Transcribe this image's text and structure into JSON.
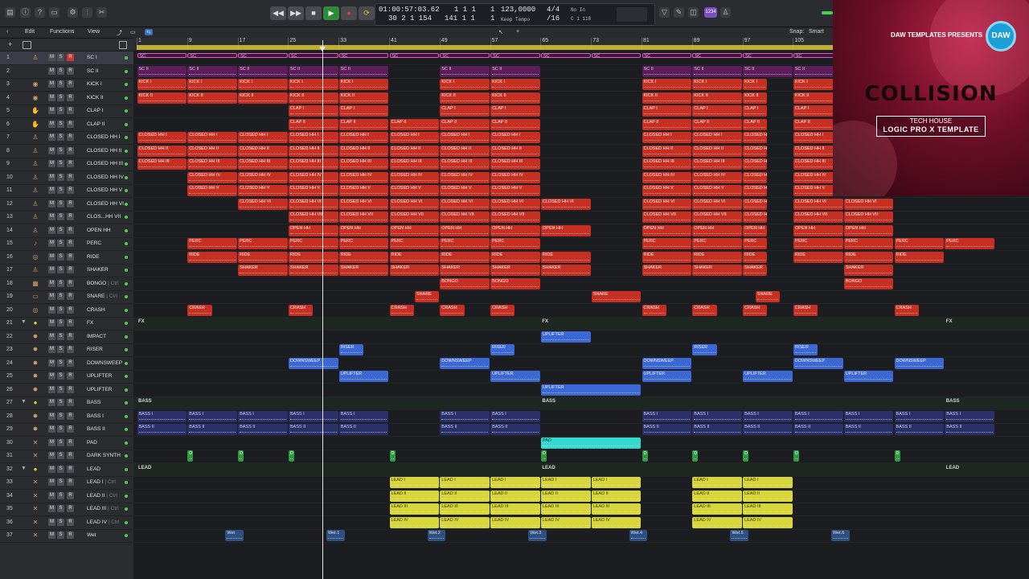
{
  "toolbar": {
    "lcd": {
      "position": "01:00:57:03.62",
      "bars": "30  2  1  154",
      "bar_beat_top": "1  1  1",
      "bar_beat_top_r": "1",
      "bar_beat_bot": "141  1  1",
      "bar_beat_bot_r": "1",
      "tempo": "123,0000",
      "tempo_mode": "Keep Tempo",
      "signature": "4/4",
      "division": "/16",
      "in_label": "No In",
      "out_label": "C  1  118"
    },
    "key_badge": "1234"
  },
  "menubar": {
    "edit": "Edit",
    "functions": "Functions",
    "view": "View",
    "snap_label": "Snap:",
    "snap_value": "Smart"
  },
  "ruler_bars": [
    "1",
    "9",
    "17",
    "25",
    "33",
    "41",
    "49",
    "57",
    "65",
    "73",
    "81",
    "89",
    "97",
    "105"
  ],
  "tracks": [
    {
      "n": "1",
      "name": "SC I",
      "icon": "♙",
      "rec": true
    },
    {
      "n": "2",
      "name": "SC II",
      "icon": ""
    },
    {
      "n": "3",
      "name": "KICK I",
      "icon": "◉"
    },
    {
      "n": "4",
      "name": "KICK II",
      "icon": "◉"
    },
    {
      "n": "5",
      "name": "CLAP I",
      "icon": "✋"
    },
    {
      "n": "6",
      "name": "CLAP II",
      "icon": "✋"
    },
    {
      "n": "7",
      "name": "CLOSED HH I",
      "icon": "♙"
    },
    {
      "n": "8",
      "name": "CLOSED HH II",
      "icon": "♙"
    },
    {
      "n": "9",
      "name": "CLOSED HH III",
      "icon": "♙"
    },
    {
      "n": "10",
      "name": "CLOSED HH IV",
      "icon": "♙"
    },
    {
      "n": "11",
      "name": "CLOSED HH V",
      "icon": "♙"
    },
    {
      "n": "12",
      "name": "CLOSED HH VI",
      "icon": "♙"
    },
    {
      "n": "13",
      "name": "CLOS...HH VII",
      "icon": "♙"
    },
    {
      "n": "14",
      "name": "OPEN HH",
      "icon": "♙"
    },
    {
      "n": "15",
      "name": "PERC",
      "icon": "♪"
    },
    {
      "n": "16",
      "name": "RIDE",
      "icon": "◎"
    },
    {
      "n": "17",
      "name": "SHAKER",
      "icon": "♙"
    },
    {
      "n": "18",
      "name": "BONGO",
      "icon": "▦",
      "suffix": "| Ctrl"
    },
    {
      "n": "19",
      "name": "SNARE",
      "icon": "▭",
      "suffix": "| Ctrl"
    },
    {
      "n": "20",
      "name": "CRASH",
      "icon": "◎"
    },
    {
      "n": "21",
      "name": "FX",
      "icon": "●",
      "folder": true
    },
    {
      "n": "22",
      "name": "IMPACT",
      "icon": "✸"
    },
    {
      "n": "23",
      "name": "RISER",
      "icon": "✸"
    },
    {
      "n": "24",
      "name": "DOWNSWEEP",
      "icon": "✸"
    },
    {
      "n": "25",
      "name": "UPLIFTER",
      "icon": "✸"
    },
    {
      "n": "26",
      "name": "UPLIFTER",
      "icon": "✸"
    },
    {
      "n": "27",
      "name": "BASS",
      "icon": "●",
      "folder": true
    },
    {
      "n": "28",
      "name": "BASS I",
      "icon": "✸"
    },
    {
      "n": "29",
      "name": "BASS II",
      "icon": "✸"
    },
    {
      "n": "30",
      "name": "PAD",
      "icon": "✕"
    },
    {
      "n": "31",
      "name": "DARK SYNTH",
      "icon": "✕"
    },
    {
      "n": "32",
      "name": "LEAD",
      "icon": "●",
      "folder": true
    },
    {
      "n": "33",
      "name": "LEAD I",
      "icon": "✕",
      "suffix": "| Ctrl"
    },
    {
      "n": "34",
      "name": "LEAD II",
      "icon": "✕",
      "suffix": "| Ctrl"
    },
    {
      "n": "35",
      "name": "LEAD III",
      "icon": "✕",
      "suffix": "| Ctrl"
    },
    {
      "n": "36",
      "name": "LEAD IV",
      "icon": "✕",
      "suffix": "| Ctrl"
    },
    {
      "n": "37",
      "name": "Wet",
      "icon": "✕"
    }
  ],
  "group_labels": [
    {
      "text": "FX",
      "row": 20,
      "bars": [
        1,
        65,
        129
      ]
    },
    {
      "text": "BASS",
      "row": 26,
      "bars": [
        1,
        65,
        129
      ]
    },
    {
      "text": "LEAD",
      "row": 31,
      "bars": [
        1,
        65,
        129
      ]
    }
  ],
  "regions": [
    {
      "row": 0,
      "c": "pink",
      "label": "SC",
      "runs": [
        [
          1,
          129
        ]
      ],
      "step": 8
    },
    {
      "row": 1,
      "c": "purple",
      "label": "SC II",
      "runs": [
        [
          1,
          41
        ],
        [
          49,
          65
        ],
        [
          81,
          113
        ]
      ],
      "step": 8
    },
    {
      "row": 2,
      "c": "red",
      "label": "KICK I",
      "runs": [
        [
          1,
          41
        ],
        [
          49,
          65
        ],
        [
          81,
          101
        ],
        [
          105,
          113
        ]
      ],
      "step": 8
    },
    {
      "row": 3,
      "c": "red",
      "label": "KICK II",
      "runs": [
        [
          1,
          41
        ],
        [
          49,
          65
        ],
        [
          81,
          101
        ],
        [
          105,
          113
        ]
      ],
      "step": 8
    },
    {
      "row": 4,
      "c": "red",
      "label": "CLAP I",
      "runs": [
        [
          25,
          41
        ],
        [
          49,
          65
        ],
        [
          81,
          101
        ],
        [
          105,
          113
        ]
      ],
      "step": 8
    },
    {
      "row": 5,
      "c": "red",
      "label": "CLAP II",
      "runs": [
        [
          25,
          65
        ],
        [
          81,
          101
        ],
        [
          105,
          113
        ]
      ],
      "step": 8
    },
    {
      "row": 6,
      "c": "red",
      "label": "CLOSED HH I",
      "runs": [
        [
          1,
          65
        ],
        [
          81,
          101
        ],
        [
          105,
          113
        ]
      ],
      "step": 8
    },
    {
      "row": 7,
      "c": "red",
      "label": "CLOSED HH II",
      "runs": [
        [
          1,
          65
        ],
        [
          81,
          101
        ],
        [
          105,
          113
        ]
      ],
      "step": 8
    },
    {
      "row": 8,
      "c": "red",
      "label": "CLOSED HH III",
      "runs": [
        [
          1,
          65
        ],
        [
          81,
          101
        ],
        [
          105,
          113
        ]
      ],
      "step": 8
    },
    {
      "row": 9,
      "c": "red",
      "label": "CLOSED HH IV",
      "runs": [
        [
          9,
          65
        ],
        [
          81,
          101
        ],
        [
          105,
          113
        ]
      ],
      "step": 8
    },
    {
      "row": 10,
      "c": "red",
      "label": "CLOSED HH V",
      "runs": [
        [
          9,
          65
        ],
        [
          81,
          101
        ],
        [
          105,
          113
        ]
      ],
      "step": 8
    },
    {
      "row": 11,
      "c": "red",
      "label": "CLOSED HH VI",
      "runs": [
        [
          17,
          73
        ],
        [
          81,
          101
        ],
        [
          105,
          121
        ]
      ],
      "step": 8
    },
    {
      "row": 12,
      "c": "red",
      "label": "CLOSED HH VII",
      "runs": [
        [
          25,
          65
        ],
        [
          81,
          101
        ],
        [
          105,
          121
        ]
      ],
      "step": 8
    },
    {
      "row": 13,
      "c": "red",
      "label": "OPEN HH",
      "runs": [
        [
          25,
          73
        ],
        [
          81,
          101
        ],
        [
          105,
          121
        ]
      ],
      "step": 8
    },
    {
      "row": 14,
      "c": "red",
      "label": "PERC",
      "runs": [
        [
          9,
          65
        ],
        [
          81,
          101
        ],
        [
          105,
          137
        ]
      ],
      "step": 8
    },
    {
      "row": 15,
      "c": "red",
      "label": "RIDE",
      "runs": [
        [
          9,
          73
        ],
        [
          81,
          101
        ],
        [
          105,
          129
        ]
      ],
      "step": 8
    },
    {
      "row": 16,
      "c": "red",
      "label": "SHAKER",
      "runs": [
        [
          17,
          73
        ],
        [
          81,
          101
        ],
        [
          113,
          121
        ]
      ],
      "step": 8
    },
    {
      "row": 17,
      "c": "red",
      "label": "BONGO",
      "runs": [
        [
          49,
          65
        ],
        [
          113,
          121
        ]
      ],
      "step": 8
    },
    {
      "row": 18,
      "c": "red",
      "label": "SNARE",
      "runs": [
        [
          45,
          49
        ],
        [
          73,
          81
        ],
        [
          99,
          103
        ]
      ],
      "step": 8
    },
    {
      "row": 19,
      "c": "red",
      "label": "CRASH",
      "runs": [
        [
          9,
          13
        ],
        [
          25,
          29
        ],
        [
          41,
          45
        ],
        [
          49,
          53
        ],
        [
          57,
          61
        ],
        [
          81,
          85
        ],
        [
          89,
          93
        ],
        [
          97,
          101
        ],
        [
          105,
          109
        ],
        [
          121,
          125
        ]
      ],
      "step": 4
    },
    {
      "row": 21,
      "c": "blue",
      "label": "UPLIFTER",
      "runs": [
        [
          65,
          73
        ]
      ],
      "step": 8
    },
    {
      "row": 22,
      "c": "blue",
      "label": "RISER",
      "runs": [
        [
          33,
          37
        ],
        [
          57,
          61
        ],
        [
          89,
          93
        ],
        [
          105,
          109
        ]
      ],
      "step": 4
    },
    {
      "row": 23,
      "c": "blue",
      "label": "DOWNSWEEP",
      "runs": [
        [
          25,
          33
        ],
        [
          49,
          57
        ],
        [
          81,
          89
        ],
        [
          105,
          113
        ],
        [
          121,
          129
        ]
      ],
      "step": 8
    },
    {
      "row": 24,
      "c": "blue",
      "label": "UPLIFTER",
      "runs": [
        [
          33,
          41
        ],
        [
          57,
          65
        ],
        [
          81,
          89
        ],
        [
          97,
          105
        ],
        [
          113,
          121
        ]
      ],
      "step": 8
    },
    {
      "row": 25,
      "c": "blue",
      "label": "UPLIFTER",
      "runs": [
        [
          65,
          81
        ]
      ],
      "step": 16
    },
    {
      "row": 27,
      "c": "navy",
      "label": "BASS I",
      "runs": [
        [
          1,
          41
        ],
        [
          49,
          65
        ],
        [
          81,
          137
        ]
      ],
      "step": 8
    },
    {
      "row": 28,
      "c": "navy",
      "label": "BASS II",
      "runs": [
        [
          1,
          41
        ],
        [
          49,
          65
        ],
        [
          81,
          137
        ]
      ],
      "step": 8
    },
    {
      "row": 29,
      "c": "cyan",
      "label": "PAD",
      "runs": [
        [
          65,
          81
        ]
      ],
      "step": 16
    },
    {
      "row": 30,
      "c": "green",
      "label": "D",
      "runs": [
        [
          9,
          10
        ],
        [
          17,
          18
        ],
        [
          25,
          26
        ],
        [
          41,
          42
        ],
        [
          65,
          66
        ],
        [
          81,
          82
        ],
        [
          89,
          90
        ],
        [
          97,
          98
        ],
        [
          105,
          106
        ],
        [
          121,
          122
        ]
      ],
      "step": 1
    },
    {
      "row": 32,
      "c": "yellow",
      "label": "LEAD I",
      "runs": [
        [
          41,
          81
        ],
        [
          89,
          105
        ]
      ],
      "step": 8
    },
    {
      "row": 33,
      "c": "yellow",
      "label": "LEAD II",
      "runs": [
        [
          41,
          81
        ],
        [
          89,
          105
        ]
      ],
      "step": 8
    },
    {
      "row": 34,
      "c": "yellow",
      "label": "LEAD III",
      "runs": [
        [
          41,
          81
        ],
        [
          89,
          105
        ]
      ],
      "step": 8
    },
    {
      "row": 35,
      "c": "yellow",
      "label": "LEAD IV",
      "runs": [
        [
          41,
          81
        ],
        [
          89,
          105
        ]
      ],
      "step": 8
    },
    {
      "row": 36,
      "c": "steel",
      "label": "Wet",
      "runs": [
        [
          15,
          18
        ],
        [
          31,
          34
        ],
        [
          47,
          50
        ],
        [
          63,
          66
        ],
        [
          79,
          82
        ],
        [
          95,
          98
        ],
        [
          111,
          114
        ]
      ],
      "step": 4,
      "names": [
        "Wet",
        "Wet.1",
        "Wet.2",
        "Wet.3",
        "Wet.4",
        "Wet.5",
        "Wet.6"
      ]
    }
  ],
  "promo": {
    "kicker": "DAW TEMPLATES PRESENTS",
    "logo": "DAW",
    "title": "COLLISION",
    "line1": "TECH HOUSE",
    "line2": "LOGIC PRO X TEMPLATE"
  }
}
